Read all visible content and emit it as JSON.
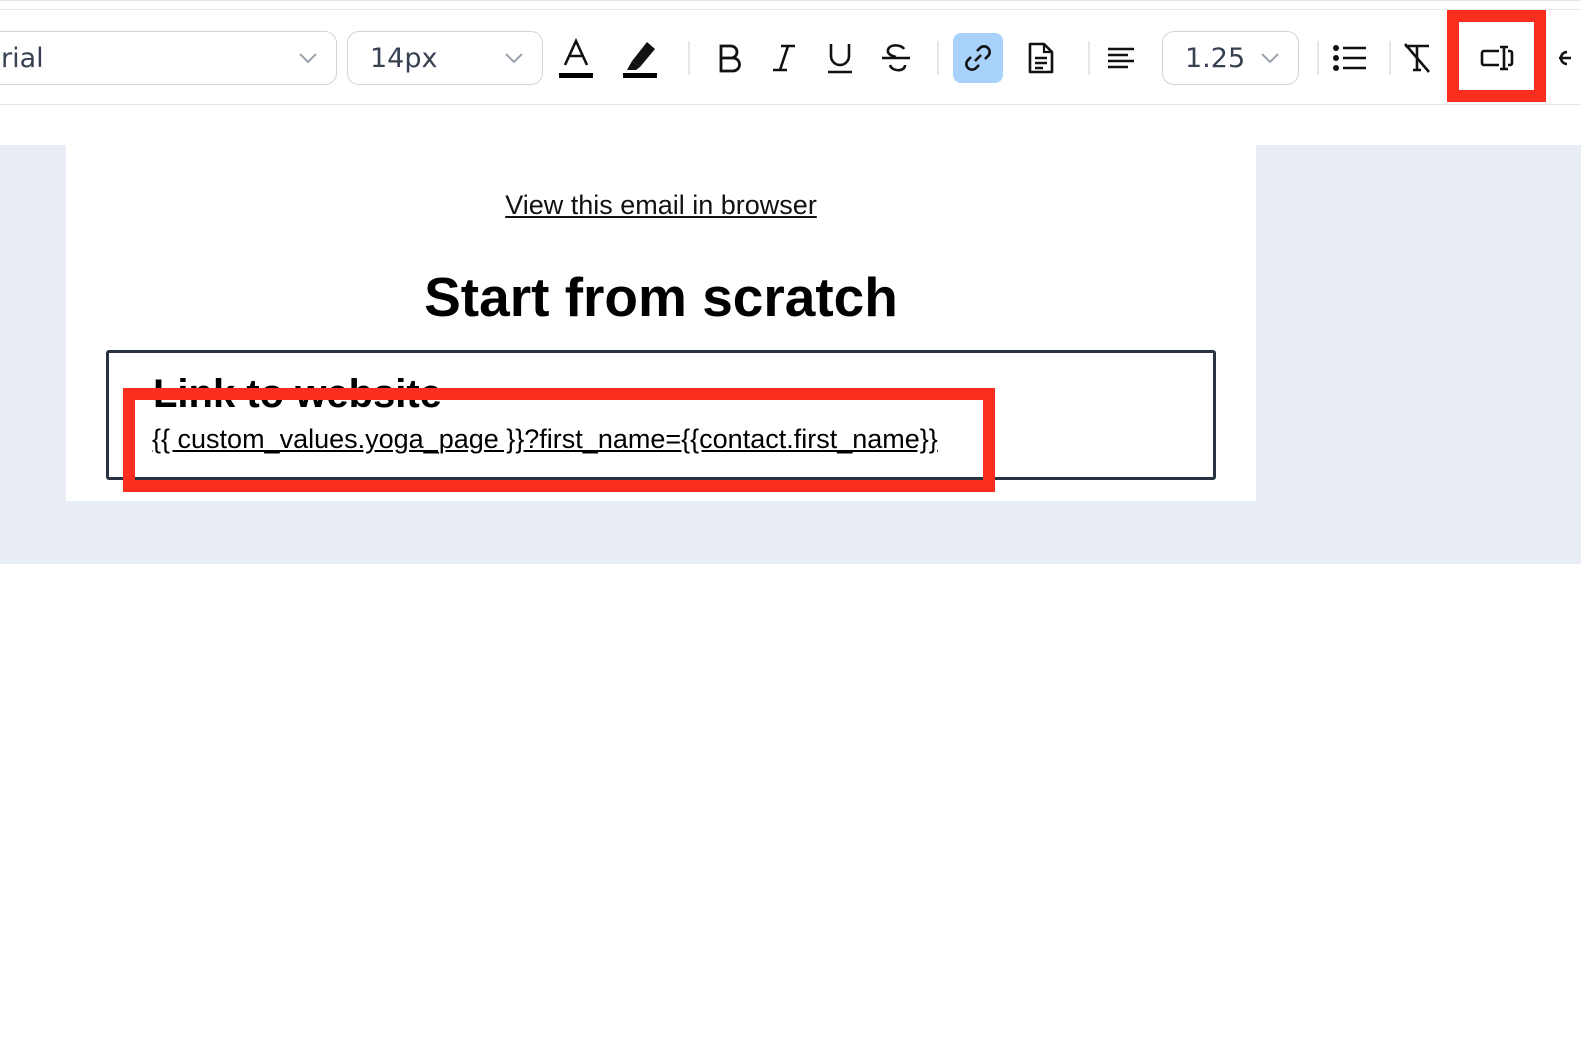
{
  "toolbar": {
    "font_family": "rial",
    "font_size": "14px",
    "line_height": "1.25",
    "icons": [
      "text-color-icon",
      "highlight-color-icon",
      "bold-icon",
      "italic-icon",
      "underline-icon",
      "strikethrough-icon",
      "link-icon",
      "document-icon",
      "align-left-icon",
      "bullet-list-icon",
      "clear-formatting-icon",
      "custom-value-icon",
      "more-icon"
    ],
    "active_button": "link-icon",
    "colors": {
      "active_background": "#a9d2fb",
      "highlight_marker": "#fa2e1e"
    }
  },
  "email": {
    "view_in_browser": "View this email in browser",
    "heading": "Start from scratch",
    "block_title": "Link to website",
    "block_link": "{{ custom_values.yoga_page }}?first_name={{contact.first_name}}",
    "canvas_background": "#e9eef6"
  }
}
